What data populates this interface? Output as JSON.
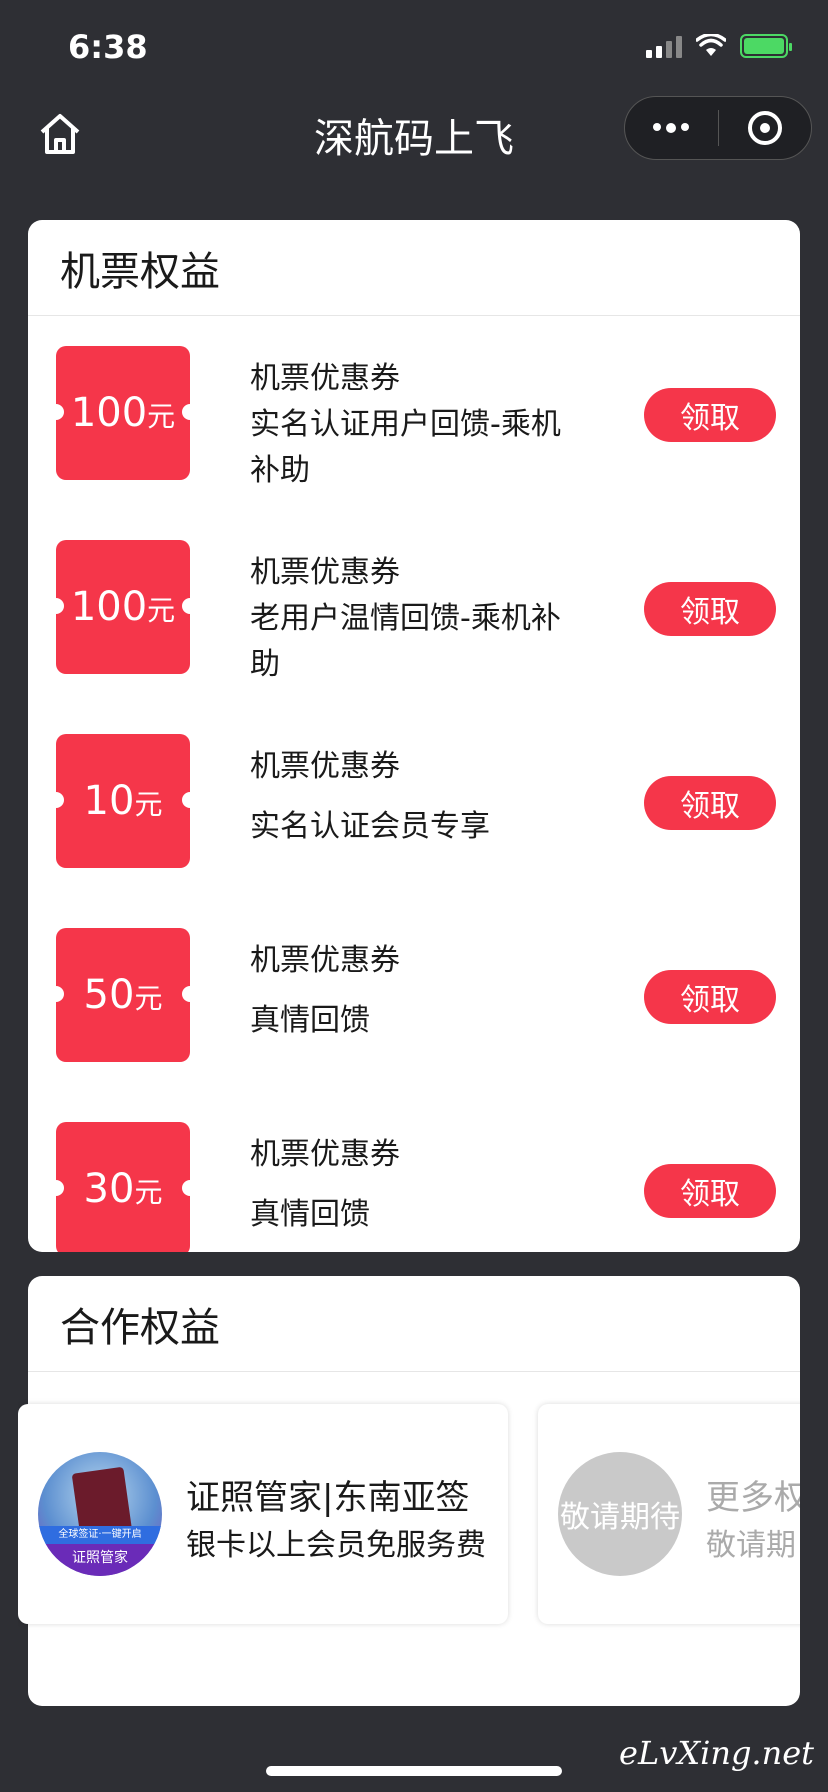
{
  "status_bar": {
    "time": "6:38"
  },
  "nav": {
    "title": "深航码上飞"
  },
  "ticket_section": {
    "title": "机票权益",
    "coupons": [
      {
        "amount": "100",
        "unit": "元",
        "name": "机票优惠券",
        "desc": "实名认证用户回馈-乘机补助",
        "button": "领取"
      },
      {
        "amount": "100",
        "unit": "元",
        "name": "机票优惠券",
        "desc": "老用户温情回馈-乘机补助",
        "button": "领取"
      },
      {
        "amount": "10",
        "unit": "元",
        "name": "机票优惠券",
        "desc": "实名认证会员专享",
        "button": "领取"
      },
      {
        "amount": "50",
        "unit": "元",
        "name": "机票优惠券",
        "desc": "真情回馈",
        "button": "领取"
      },
      {
        "amount": "30",
        "unit": "元",
        "name": "机票优惠券",
        "desc": "真情回馈",
        "button": "领取"
      }
    ]
  },
  "partner_section": {
    "title": "合作权益",
    "items": [
      {
        "name": "证照管家|东南亚签",
        "desc": "银卡以上会员免服务费",
        "logo_band": "全球签证·一键开启",
        "logo_brand": "证照管家"
      },
      {
        "name": "更多权",
        "desc": "敬请期",
        "circle_text": "敬请期待"
      }
    ]
  },
  "watermark": "eLvXing.net",
  "colors": {
    "accent": "#f5364a",
    "background": "#2e2f34"
  }
}
